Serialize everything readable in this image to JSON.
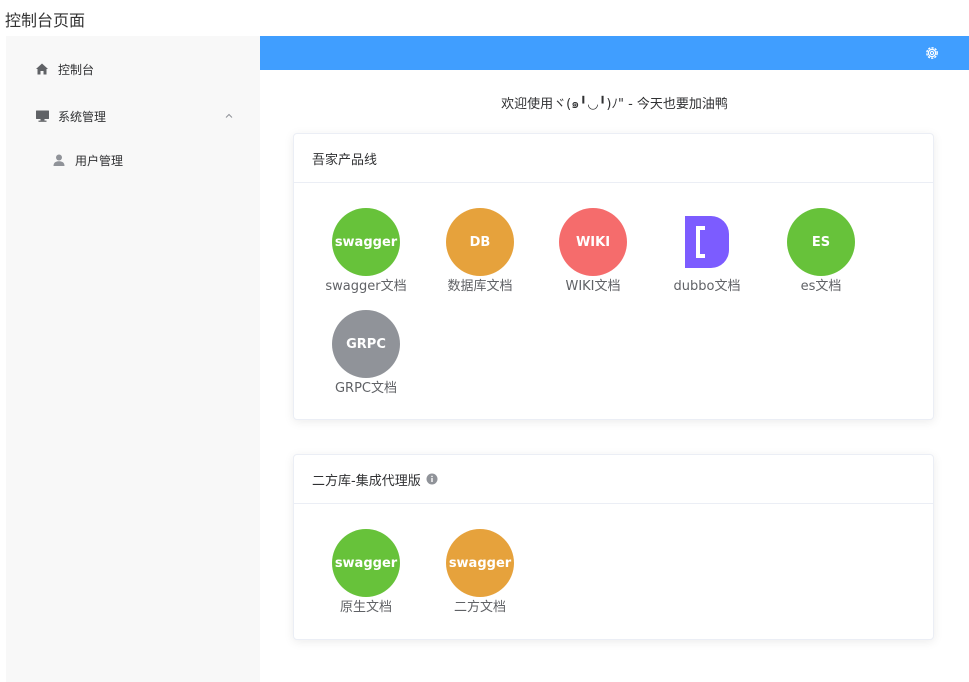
{
  "page": {
    "caption": "控制台页面"
  },
  "sidebar": {
    "items": [
      {
        "label": "控制台",
        "icon": "home-icon"
      },
      {
        "label": "系统管理",
        "icon": "monitor-icon"
      },
      {
        "label": "用户管理",
        "icon": "user-icon"
      }
    ]
  },
  "header": {
    "settings_icon": "gear-icon",
    "bg_color": "#409eff"
  },
  "welcome": {
    "text": "欢迎使用ヾ(๑╹◡╹)ﾉ\" - 今天也要加油鸭"
  },
  "product_line": {
    "title": "吾家产品线",
    "tiles": [
      {
        "badge": "swagger",
        "label": "swagger文档",
        "color": "#67c23a"
      },
      {
        "badge": "DB",
        "label": "数据库文档",
        "color": "#e6a23c"
      },
      {
        "badge": "WIKI",
        "label": "WIKI文档",
        "color": "#f56c6c"
      },
      {
        "badge": "",
        "label": "dubbo文档",
        "color": "#7c5cff",
        "icon": "dubbo-bracket-icon"
      },
      {
        "badge": "ES",
        "label": "es文档",
        "color": "#67c23a"
      },
      {
        "badge": "GRPC",
        "label": "GRPC文档",
        "color": "#909399"
      }
    ]
  },
  "second_party": {
    "title": "二方库-集成代理版",
    "info_icon": "info-icon",
    "tiles": [
      {
        "badge": "swagger",
        "label": "原生文档",
        "color": "#67c23a"
      },
      {
        "badge": "swagger",
        "label": "二方文档",
        "color": "#e6a23c"
      }
    ]
  }
}
